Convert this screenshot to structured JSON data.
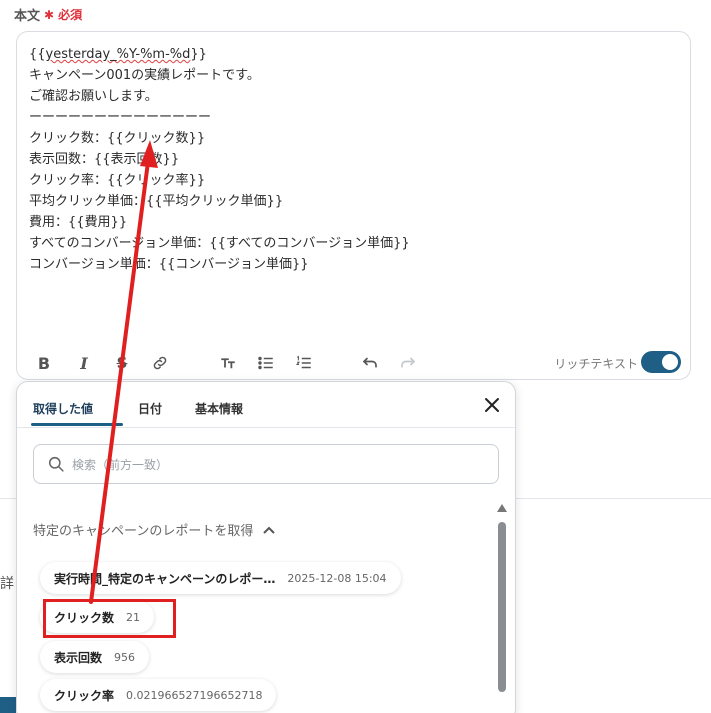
{
  "field": {
    "label": "本文",
    "required_mark": "✱",
    "required_text": "必須"
  },
  "editor": {
    "lines": [
      "{{yesterday_%Y-%m-%d}}",
      "キャンペーン001の実績レポートです。",
      "ご確認お願いします。",
      "ーーーーーーーーーーーーーー",
      "クリック数：{{クリック数}}",
      "表示回数：{{表示回数}}",
      "クリック率：{{クリック率}}",
      "平均クリック単価：{{平均クリック単価}}",
      "費用：{{費用}}",
      "すべてのコンバージョン単価：{{すべてのコンバージョン単価}}",
      "コンバージョン単価：{{コンバージョン単価}}"
    ],
    "toolbar": {
      "icons": [
        "bold-icon",
        "italic-icon",
        "strikethrough-icon",
        "link-icon",
        "heading-icon",
        "bullet-list-icon",
        "numbered-list-icon",
        "undo-icon",
        "redo-icon"
      ],
      "rich_text_label": "リッチテキスト",
      "rich_text_enabled": true
    }
  },
  "popup": {
    "tabs": [
      {
        "label": "取得した値",
        "active": true
      },
      {
        "label": "日付",
        "active": false
      },
      {
        "label": "基本情報",
        "active": false
      }
    ],
    "search_placeholder": "検索（前方一致）",
    "section_title": "特定のキャンペーンのレポートを取得",
    "items": [
      {
        "key": "実行時間_特定のキャンペーンのレポー…",
        "value": "2025-12-08 15:04"
      },
      {
        "key": "クリック数",
        "value": "21"
      },
      {
        "key": "表示回数",
        "value": "956"
      },
      {
        "key": "クリック率",
        "value": "0.021966527196652718"
      }
    ]
  },
  "background": {
    "partial_text": "詳"
  },
  "annotation": {
    "color": "#e02020",
    "highlighted_item": "クリック数"
  }
}
